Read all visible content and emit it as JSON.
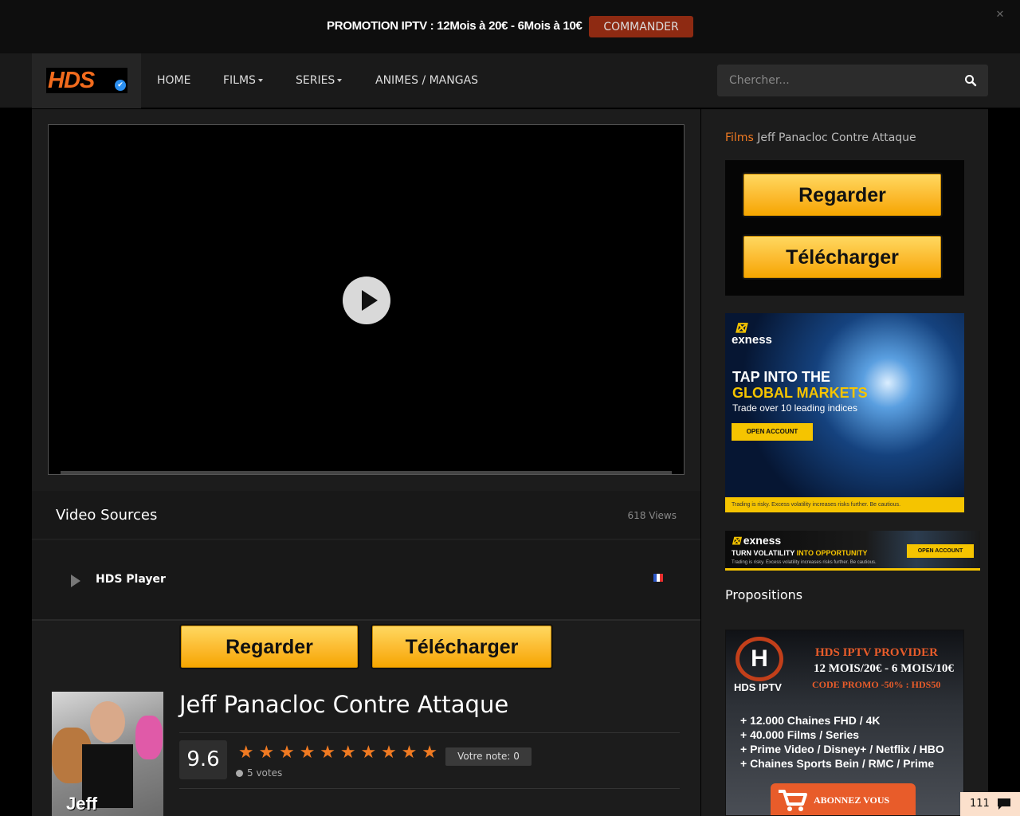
{
  "promo": {
    "text": "PROMOTION IPTV : 12Mois à 20€ - 6Mois à 10€",
    "button": "COMMANDER",
    "close": "✕"
  },
  "header": {
    "logo": "HDS",
    "nav": [
      {
        "label": "HOME"
      },
      {
        "label": "FILMS",
        "dropdown": true
      },
      {
        "label": "SERIES",
        "dropdown": true
      },
      {
        "label": "ANIMES / MANGAS"
      }
    ],
    "search": {
      "placeholder": "Chercher...",
      "icon": "search-icon"
    }
  },
  "player": {
    "state": "paused",
    "play_icon": "play-icon"
  },
  "sources": {
    "title": "Video Sources",
    "views": "618 Views",
    "items": [
      {
        "name": "HDS Player",
        "flag": "fr"
      }
    ]
  },
  "buttons": {
    "regarder": "Regarder",
    "telecharger": "Télécharger"
  },
  "movie": {
    "poster_title": "Jeff Panacloc",
    "title": "Jeff Panacloc Contre Attaque",
    "rating": "9.6",
    "stars": 10,
    "votes": "5 votes",
    "user_rating": "Votre note: 0"
  },
  "breadcrumb": {
    "section": "Films",
    "current": "Jeff Panacloc Contre Attaque"
  },
  "ads": {
    "exness1": {
      "brand": "exness",
      "line1": "TAP INTO THE",
      "line2": "GLOBAL MARKETS",
      "sub": "Trade over 10 leading indices",
      "button": "OPEN ACCOUNT",
      "footer": "Trading is risky. Excess volatility increases risks further. Be cautious."
    },
    "exness2": {
      "brand": "exness",
      "line_a": "TURN VOLATILITY ",
      "line_b": "INTO OPPORTUNITY",
      "footer": "Trading is risky. Excess volatility increases risks further. Be cautious.",
      "button": "OPEN ACCOUNT"
    },
    "iptv": {
      "name": "HDS IPTV",
      "h1": "HDS IPTV PROVIDER",
      "h2": "12 MOIS/20€ - 6 MOIS/10€",
      "h3": "CODE PROMO -50% : HDS50",
      "features": [
        "+ 12.000 Chaines FHD / 4K",
        "+ 40.000 Films / Series",
        "+ Prime Video / Disney+ / Netflix / HBO",
        "+ Chaines Sports Bein / RMC / Prime"
      ],
      "cta": "ABONNEZ VOUS"
    }
  },
  "propositions_title": "Propositions",
  "comments": {
    "count": "111"
  },
  "colors": {
    "accent": "#f07a22",
    "gold": "#fbb82a",
    "promo_btn": "#8e2a12"
  }
}
